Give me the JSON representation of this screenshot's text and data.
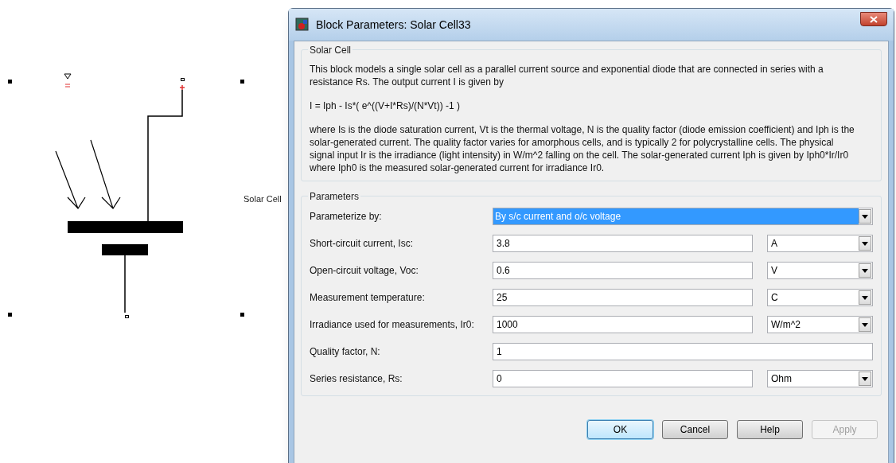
{
  "window": {
    "title": "Block Parameters: Solar Cell33"
  },
  "canvas": {
    "block_label": "Solar Cell"
  },
  "description": {
    "title": "Solar Cell",
    "paragraphs": [
      "This block models a single solar cell as a parallel current source and exponential diode that are connected in series with a resistance Rs. The output current I is given by",
      "I = Iph - Is*( e^((V+I*Rs)/(N*Vt)) -1 )",
      "where Is is the diode saturation current, Vt is the thermal voltage, N is the quality factor (diode emission coefficient) and Iph is the solar-generated current. The quality factor varies for amorphous cells, and is typically 2 for polycrystalline cells. The physical signal input Ir is the irradiance (light intensity) in W/m^2 falling on the cell. The solar-generated current Iph is given by Iph0*Ir/Ir0 where Iph0 is the measured solar-generated current for irradiance Ir0."
    ]
  },
  "parameters": {
    "title": "Parameters",
    "rows": [
      {
        "kind": "dropdown",
        "label": "Parameterize by:",
        "value": "By s/c current and o/c voltage",
        "highlighted": true
      },
      {
        "kind": "value_unit",
        "label": "Short-circuit current, Isc:",
        "value": "3.8",
        "unit": "A",
        "highlighted": false
      },
      {
        "kind": "value_unit",
        "label": "Open-circuit voltage, Voc:",
        "value": "0.6",
        "unit": "V",
        "highlighted": false
      },
      {
        "kind": "value_unit",
        "label": "Measurement temperature:",
        "value": "25",
        "unit": "C",
        "highlighted": false
      },
      {
        "kind": "value_unit",
        "label": "Irradiance used for measurements, Ir0:",
        "value": "1000",
        "unit": "W/m^2",
        "highlighted": false
      },
      {
        "kind": "value",
        "label": "Quality factor, N:",
        "value": "1",
        "highlighted": false
      },
      {
        "kind": "value_unit",
        "label": "Series resistance, Rs:",
        "value": "0",
        "unit": "Ohm",
        "highlighted": false
      }
    ]
  },
  "buttons": [
    {
      "label": "OK",
      "default": true,
      "disabled": false
    },
    {
      "label": "Cancel",
      "default": false,
      "disabled": false
    },
    {
      "label": "Help",
      "default": false,
      "disabled": false
    },
    {
      "label": "Apply",
      "default": false,
      "disabled": true
    }
  ]
}
